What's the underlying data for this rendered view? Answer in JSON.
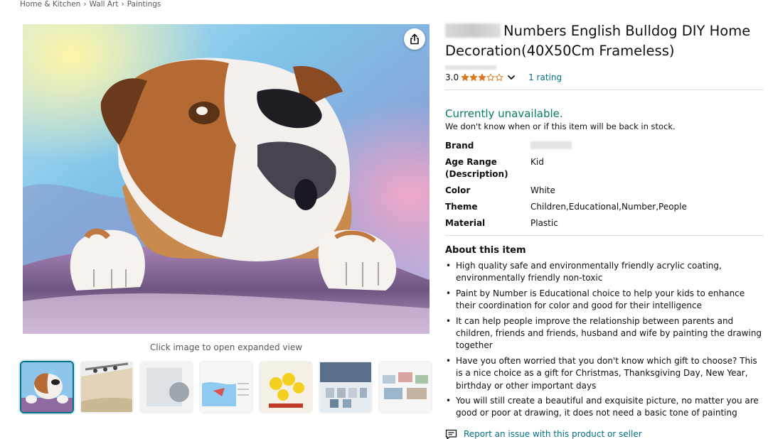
{
  "breadcrumb": [
    "Home & Kitchen",
    "Wall Art",
    "Paintings"
  ],
  "breadcrumb_sep": "›",
  "main_image": {
    "hint": "Click image to open expanded view"
  },
  "product": {
    "title": "Numbers English Bulldog DIY Home Decoration(40X50Cm Frameless)",
    "rating_value": "3.0",
    "rating_stars": 3,
    "rating_count_label": "1 rating",
    "availability": "Currently unavailable.",
    "availability_note": "We don't know when or if this item will be back in stock."
  },
  "specs": [
    {
      "key": "Brand",
      "value": ""
    },
    {
      "key": "Age Range (Description)",
      "value": "Kid"
    },
    {
      "key": "Color",
      "value": "White"
    },
    {
      "key": "Theme",
      "value": "Children,Educational,Number,People"
    },
    {
      "key": "Material",
      "value": "Plastic"
    }
  ],
  "about": {
    "heading": "About this item",
    "bullets": [
      "High quality safe and environmentally friendly acrylic coating, environmentally friendly non-toxic",
      "Paint by Number is Educational choice to help your kids to enhance their coordination for color and good for their intelligence",
      "It can help people improve the relationship between parents and children, friends and friends, husband and wife by painting the drawing together",
      "Have you often worried that you don't know which gift to choose? This is a nice choice as a gift for Christmas, Thanksgiving Day, New Year, birthday or other important days",
      "You will still create a beautiful and exquisite picture, no matter you are good or poor at drawing, it does not need a basic tone of painting"
    ]
  },
  "report_link": "Report an issue with this product or seller",
  "colors": {
    "link": "#007185",
    "available": "#067d62",
    "star": "#de7921"
  },
  "icons": {
    "share": "share-icon",
    "report": "report-flag-icon",
    "chevron": "chevron-down-icon",
    "star": "star-icon"
  }
}
